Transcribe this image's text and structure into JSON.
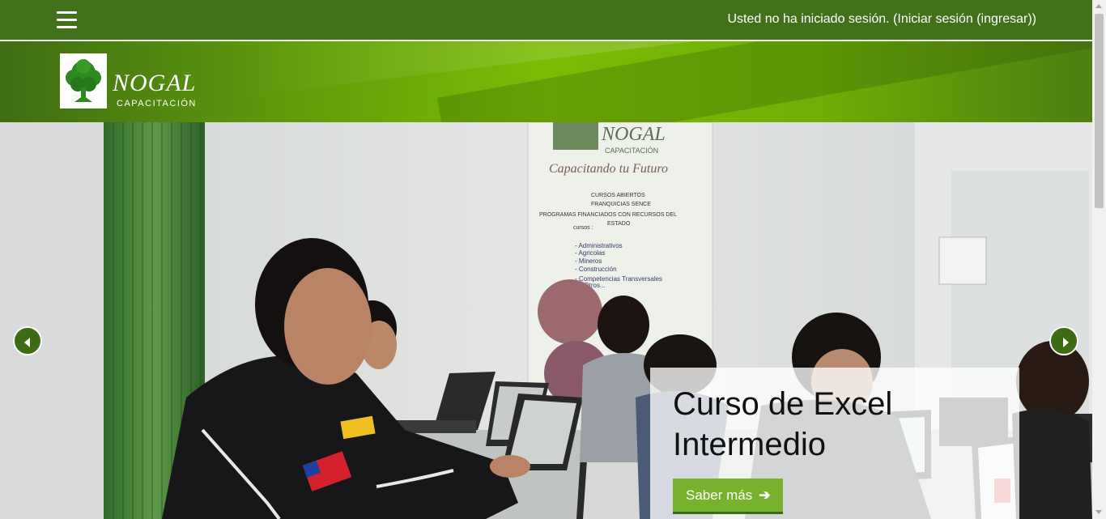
{
  "topbar": {
    "login_text": "Usted no ha iniciado sesión. (",
    "login_link": "Iniciar sesión (ingresar)",
    "login_close": ")"
  },
  "logo": {
    "name": "NOGAL",
    "subtitle": "CAPACITACIÓN"
  },
  "banner": {
    "name": "NOGAL",
    "subtitle": "CAPACITACIÓN",
    "slogan": "Capacitando tu Futuro",
    "line1": "CURSOS ABIERTOS",
    "line2": "FRANQUICIAS SENCE",
    "line3": "PROGRAMAS FINANCIADOS CON RECURSOS DEL",
    "line4": "ESTADO",
    "cursos_label": "cursos :",
    "items": [
      "- Administrativos",
      "- Agricolas",
      "- Mineros",
      "- Construcción",
      "- Competencias Transversales",
      "Y Otros..."
    ]
  },
  "slide": {
    "title": "Curso de Excel Intermedio",
    "button_label": "Saber más"
  },
  "colors": {
    "navbar": "#41711b",
    "button": "#77b22f",
    "arrow": "#3e6c15"
  }
}
